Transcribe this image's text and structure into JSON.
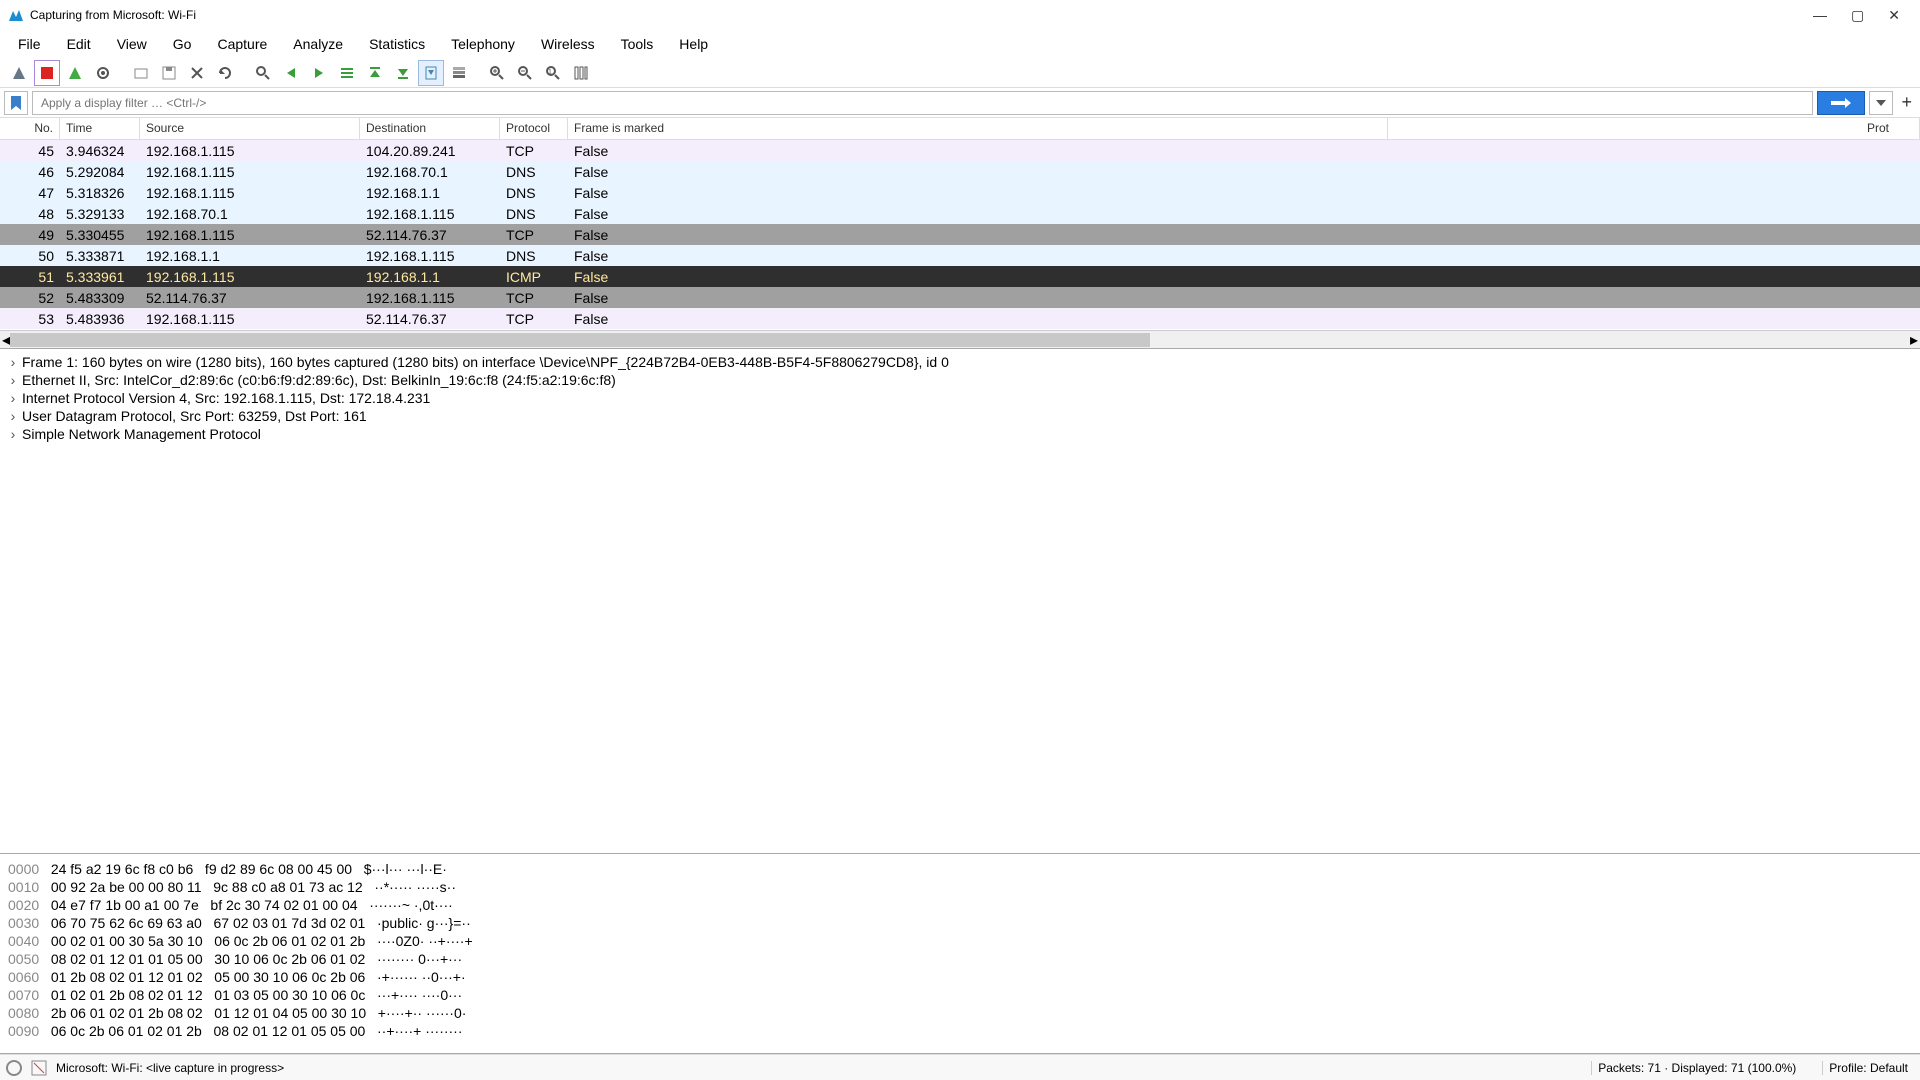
{
  "window": {
    "title": "Capturing from Microsoft: Wi-Fi"
  },
  "menubar": [
    "File",
    "Edit",
    "View",
    "Go",
    "Capture",
    "Analyze",
    "Statistics",
    "Telephony",
    "Wireless",
    "Tools",
    "Help"
  ],
  "filter": {
    "placeholder": "Apply a display filter … <Ctrl-/>"
  },
  "columns": {
    "no": "No.",
    "time": "Time",
    "src": "Source",
    "dst": "Destination",
    "proto": "Protocol",
    "mark": "Frame is marked",
    "tail": "Prot"
  },
  "rows": [
    {
      "no": "45",
      "time": "3.946324",
      "src": "192.168.1.115",
      "dst": "104.20.89.241",
      "proto": "TCP",
      "mark": "False",
      "class": "row-lavender"
    },
    {
      "no": "46",
      "time": "5.292084",
      "src": "192.168.1.115",
      "dst": "192.168.70.1",
      "proto": "DNS",
      "mark": "False",
      "class": "row-light"
    },
    {
      "no": "47",
      "time": "5.318326",
      "src": "192.168.1.115",
      "dst": "192.168.1.1",
      "proto": "DNS",
      "mark": "False",
      "class": "row-light"
    },
    {
      "no": "48",
      "time": "5.329133",
      "src": "192.168.70.1",
      "dst": "192.168.1.115",
      "proto": "DNS",
      "mark": "False",
      "class": "row-light"
    },
    {
      "no": "49",
      "time": "5.330455",
      "src": "192.168.1.115",
      "dst": "52.114.76.37",
      "proto": "TCP",
      "mark": "False",
      "class": "row-gray"
    },
    {
      "no": "50",
      "time": "5.333871",
      "src": "192.168.1.1",
      "dst": "192.168.1.115",
      "proto": "DNS",
      "mark": "False",
      "class": "row-light"
    },
    {
      "no": "51",
      "time": "5.333961",
      "src": "192.168.1.115",
      "dst": "192.168.1.1",
      "proto": "ICMP",
      "mark": "False",
      "class": "row-selected"
    },
    {
      "no": "52",
      "time": "5.483309",
      "src": "52.114.76.37",
      "dst": "192.168.1.115",
      "proto": "TCP",
      "mark": "False",
      "class": "row-gray"
    },
    {
      "no": "53",
      "time": "5.483936",
      "src": "192.168.1.115",
      "dst": "52.114.76.37",
      "proto": "TCP",
      "mark": "False",
      "class": "row-lavender"
    }
  ],
  "details": [
    "Frame 1: 160 bytes on wire (1280 bits), 160 bytes captured (1280 bits) on interface \\Device\\NPF_{224B72B4-0EB3-448B-B5F4-5F8806279CD8}, id 0",
    "Ethernet II, Src: IntelCor_d2:89:6c (c0:b6:f9:d2:89:6c), Dst: BelkinIn_19:6c:f8 (24:f5:a2:19:6c:f8)",
    "Internet Protocol Version 4, Src: 192.168.1.115, Dst: 172.18.4.231",
    "User Datagram Protocol, Src Port: 63259, Dst Port: 161",
    "Simple Network Management Protocol"
  ],
  "hex": [
    {
      "off": "0000",
      "h1": "24 f5 a2 19 6c f8 c0 b6",
      "h2": "f9 d2 89 6c 08 00 45 00",
      "a": "$···l··· ···l··E·"
    },
    {
      "off": "0010",
      "h1": "00 92 2a be 00 00 80 11",
      "h2": "9c 88 c0 a8 01 73 ac 12",
      "a": "··*····· ·····s··"
    },
    {
      "off": "0020",
      "h1": "04 e7 f7 1b 00 a1 00 7e",
      "h2": "bf 2c 30 74 02 01 00 04",
      "a": "·······~ ·,0t····"
    },
    {
      "off": "0030",
      "h1": "06 70 75 62 6c 69 63 a0",
      "h2": "67 02 03 01 7d 3d 02 01",
      "a": "·public· g···}=··"
    },
    {
      "off": "0040",
      "h1": "00 02 01 00 30 5a 30 10",
      "h2": "06 0c 2b 06 01 02 01 2b",
      "a": "····0Z0· ··+····+"
    },
    {
      "off": "0050",
      "h1": "08 02 01 12 01 01 05 00",
      "h2": "30 10 06 0c 2b 06 01 02",
      "a": "········ 0···+···"
    },
    {
      "off": "0060",
      "h1": "01 2b 08 02 01 12 01 02",
      "h2": "05 00 30 10 06 0c 2b 06",
      "a": "·+······ ··0···+·"
    },
    {
      "off": "0070",
      "h1": "01 02 01 2b 08 02 01 12",
      "h2": "01 03 05 00 30 10 06 0c",
      "a": "···+···· ····0···"
    },
    {
      "off": "0080",
      "h1": "2b 06 01 02 01 2b 08 02",
      "h2": "01 12 01 04 05 00 30 10",
      "a": "+····+·· ······0·"
    },
    {
      "off": "0090",
      "h1": "06 0c 2b 06 01 02 01 2b",
      "h2": "08 02 01 12 01 05 05 00",
      "a": "··+····+ ········"
    }
  ],
  "status": {
    "left": "Microsoft: Wi-Fi: <live capture in progress>",
    "packets": "Packets: 71 · Displayed: 71 (100.0%)",
    "profile": "Profile: Default"
  }
}
